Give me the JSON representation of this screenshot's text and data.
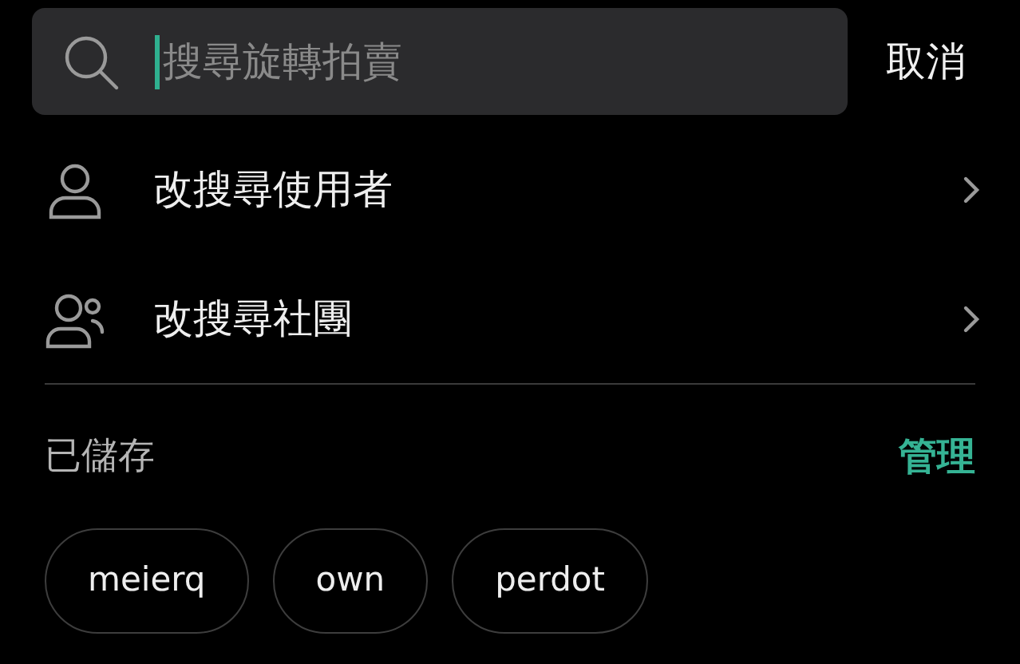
{
  "search": {
    "placeholder": "搜尋旋轉拍賣",
    "focused": true
  },
  "cancel": "取消",
  "options": [
    {
      "kind": "user",
      "label": "改搜尋使用者"
    },
    {
      "kind": "group",
      "label": "改搜尋社團"
    }
  ],
  "saved": {
    "title": "已儲存",
    "action": "管理",
    "chips": [
      "meierq",
      "own",
      "perdot"
    ]
  }
}
